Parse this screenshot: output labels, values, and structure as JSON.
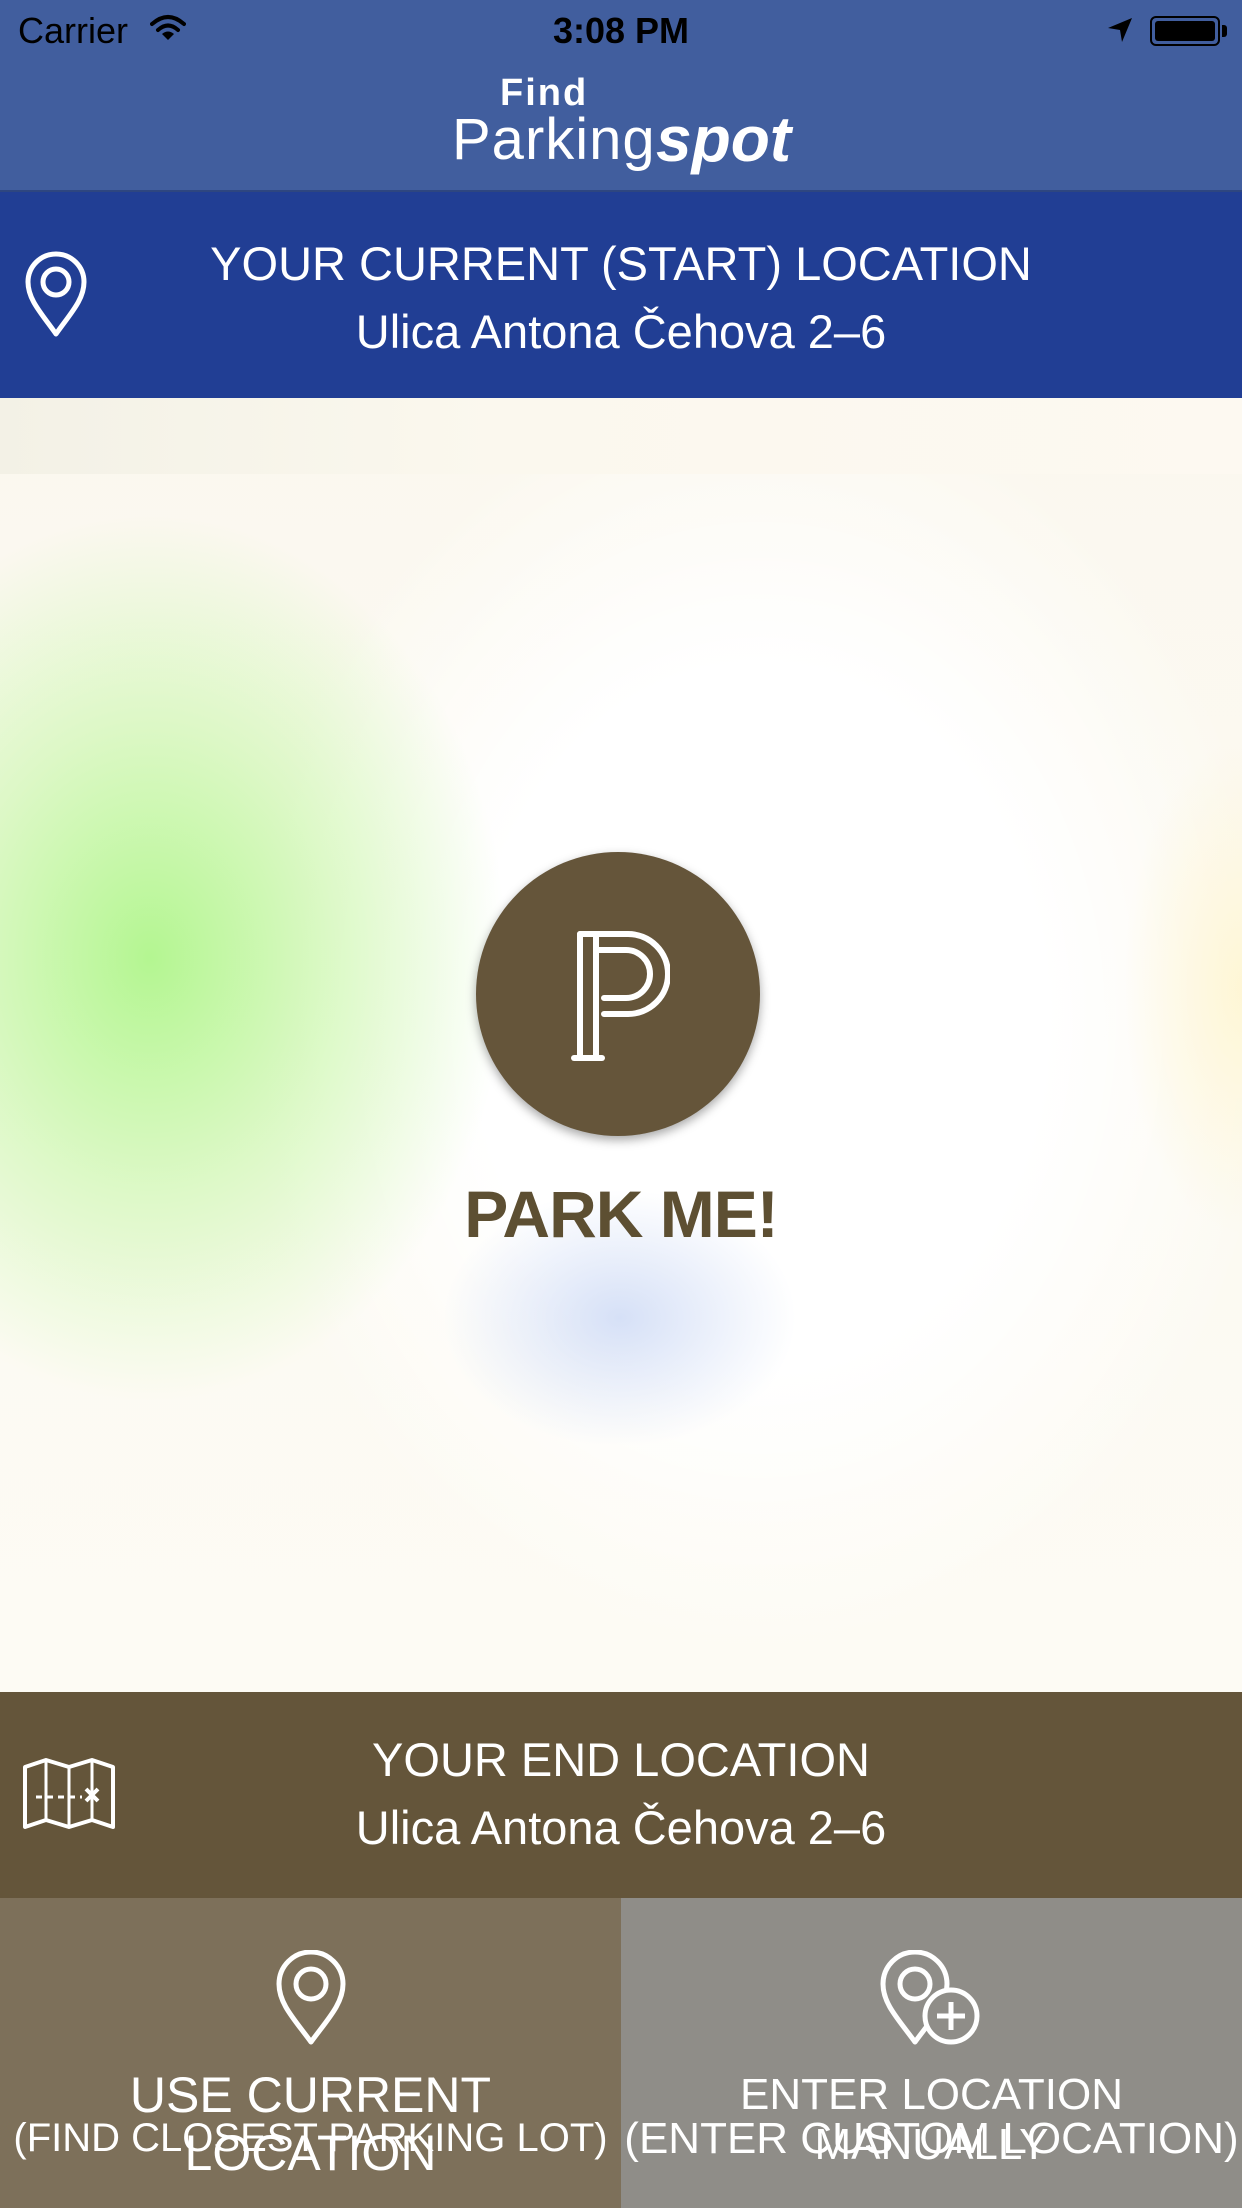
{
  "status_bar": {
    "carrier": "Carrier",
    "time": "3:08 PM",
    "icons": [
      "wifi-icon",
      "location-arrow-icon",
      "battery-icon"
    ]
  },
  "header": {
    "logo": {
      "find": "Find",
      "parking": "Parking",
      "spot": "spot"
    },
    "background_color": "#415e9e"
  },
  "start_location": {
    "title": "YOUR CURRENT (START) LOCATION",
    "address": "Ulica Antona Čehova 2–6",
    "icon": "location-pin-icon",
    "background_color": "#213e94"
  },
  "map": {
    "action_icon": "parking-p-icon",
    "action_label": "PARK ME!",
    "accent_color": "#65553a"
  },
  "end_location": {
    "title": "YOUR END LOCATION",
    "address": "Ulica Antona Čehova 2–6",
    "icon": "folded-map-icon",
    "background_color": "#64553a"
  },
  "buttons": {
    "use_current": {
      "line1": "USE CURRENT LOCATION",
      "line2": "(FIND CLOSEST PARKING LOT)",
      "icon": "location-pin-icon",
      "background_color": "#7d705a"
    },
    "enter_manual": {
      "line1": "ENTER LOCATION MANUALLY",
      "line2": "(ENTER CUSTOM LOCATION)",
      "icon": "add-location-icon",
      "background_color": "#8f8d88"
    }
  }
}
